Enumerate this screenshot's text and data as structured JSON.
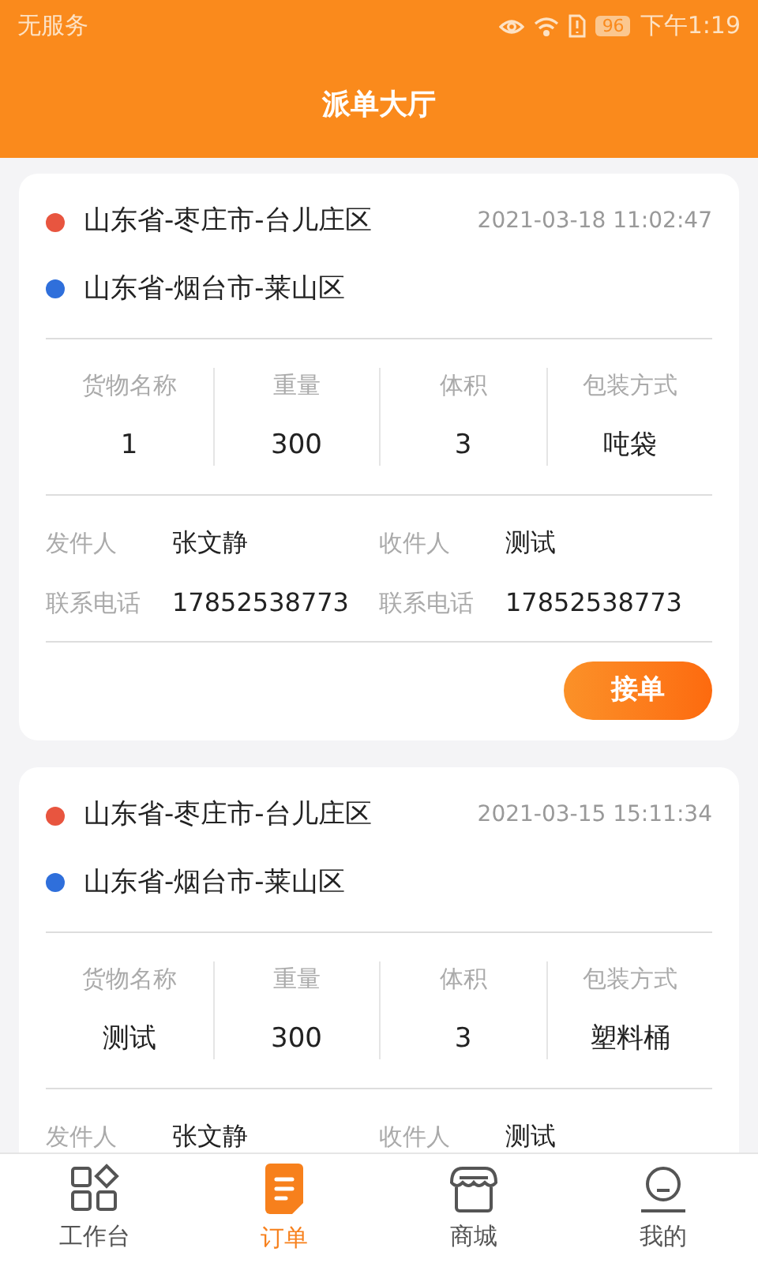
{
  "status_bar": {
    "carrier": "无服务",
    "battery": "96",
    "time": "下午1:19"
  },
  "header": {
    "title": "派单大厅"
  },
  "orders": [
    {
      "addresses": [
        {
          "text": "山东省-枣庄市-台儿庄区",
          "color": "#e8553f"
        },
        {
          "text": "山东省-烟台市-莱山区",
          "color": "#2f6fdb"
        }
      ],
      "time": "2021-03-18 11:02:47",
      "goods": [
        {
          "label": "货物名称",
          "value": "1"
        },
        {
          "label": "重量",
          "value": "300"
        },
        {
          "label": "体积",
          "value": "3"
        },
        {
          "label": "包装方式",
          "value": "吨袋"
        }
      ],
      "contacts": [
        [
          {
            "label": "发件人",
            "value": "张文静"
          },
          {
            "label": "收件人",
            "value": "测试"
          }
        ],
        [
          {
            "label": "联系电话",
            "value": "17852538773"
          },
          {
            "label": "联系电话",
            "value": "17852538773"
          }
        ]
      ],
      "button": "接单"
    },
    {
      "addresses": [
        {
          "text": "山东省-枣庄市-台儿庄区",
          "color": "#e8553f"
        },
        {
          "text": "山东省-烟台市-莱山区",
          "color": "#2f6fdb"
        }
      ],
      "time": "2021-03-15 15:11:34",
      "goods": [
        {
          "label": "货物名称",
          "value": "测试"
        },
        {
          "label": "重量",
          "value": "300"
        },
        {
          "label": "体积",
          "value": "3"
        },
        {
          "label": "包装方式",
          "value": "塑料桶"
        }
      ],
      "contacts": [
        [
          {
            "label": "发件人",
            "value": "张文静"
          },
          {
            "label": "收件人",
            "value": "测试"
          }
        ]
      ]
    }
  ],
  "tab_bar": [
    {
      "kind": "workbench",
      "label": "工作台",
      "selected": false
    },
    {
      "kind": "orders",
      "label": "订单",
      "selected": true
    },
    {
      "kind": "mall",
      "label": "商城",
      "selected": false
    },
    {
      "kind": "profile",
      "label": "我的",
      "selected": false
    }
  ]
}
